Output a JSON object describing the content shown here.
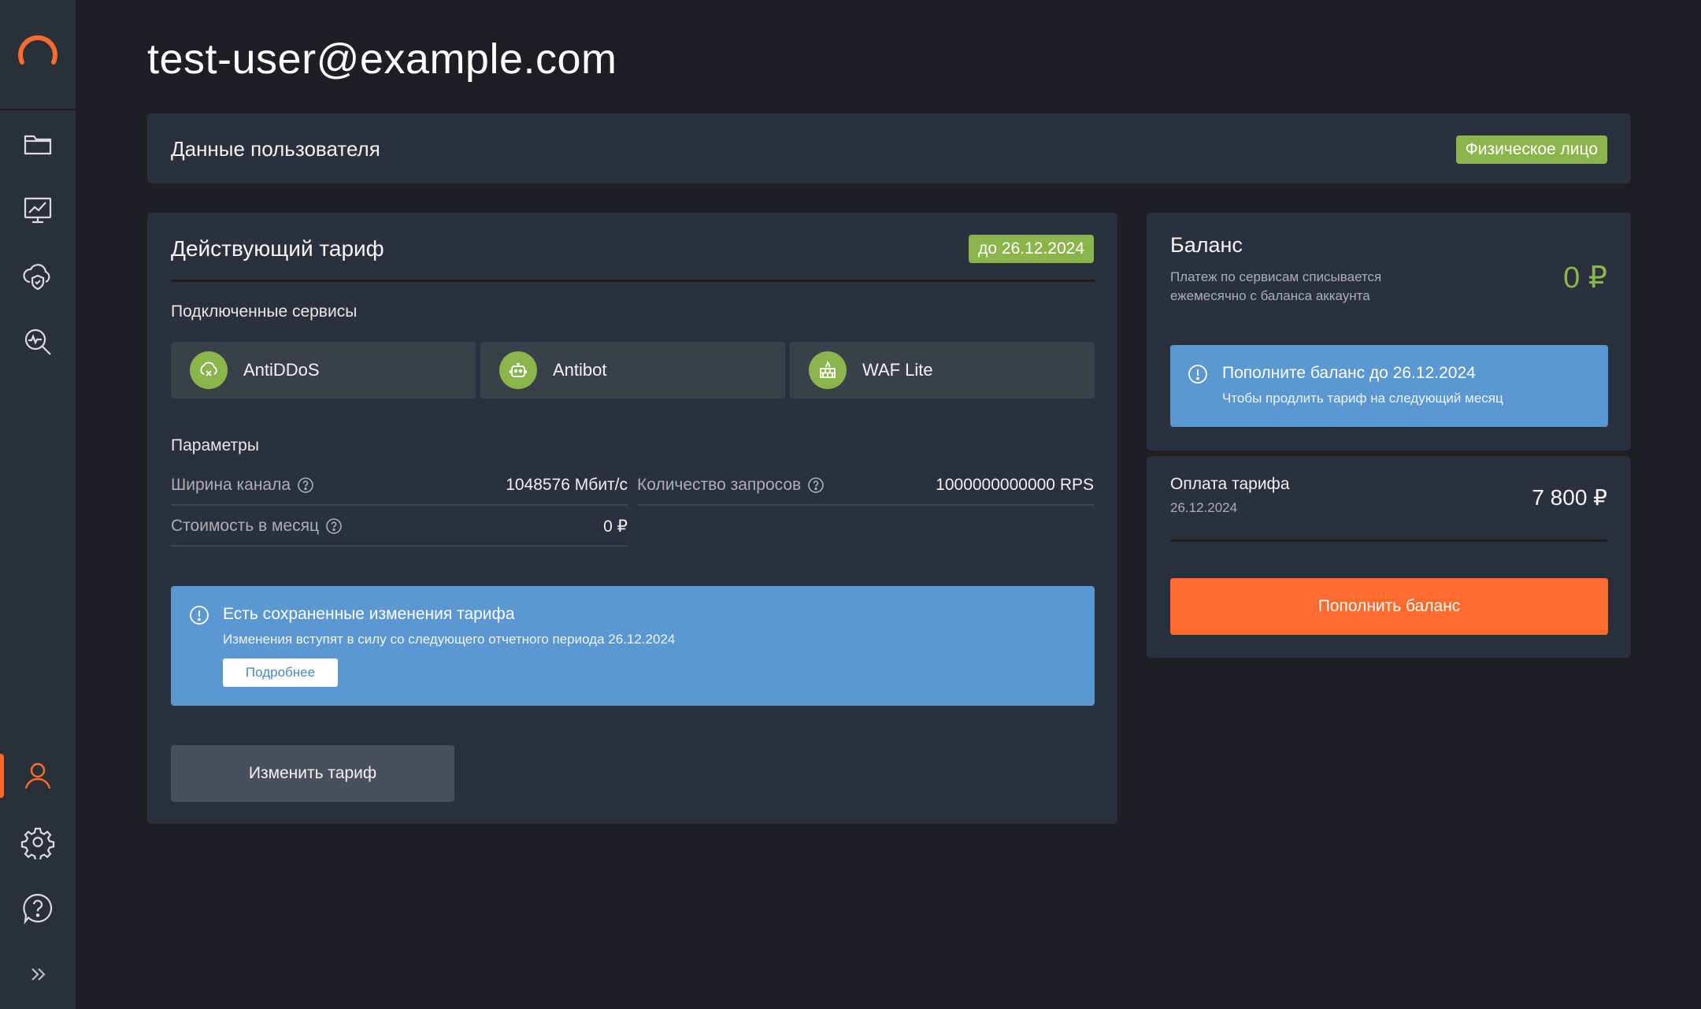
{
  "colors": {
    "accent": "#ff6b2c",
    "success": "#8bb44a",
    "info": "#5b97d0",
    "sidebar": "#2a303a",
    "panel": "#2b313c",
    "background": "#1d1f24"
  },
  "sidebar": {
    "logo": "logo-icon",
    "items": [
      {
        "icon": "folder-icon"
      },
      {
        "icon": "monitor-chart-icon"
      },
      {
        "icon": "cloud-shield-icon"
      },
      {
        "icon": "search-analytics-icon"
      },
      {
        "icon": "user-icon",
        "active": true
      },
      {
        "icon": "gear-icon"
      },
      {
        "icon": "help-icon"
      },
      {
        "icon": "expand-icon"
      }
    ]
  },
  "header": {
    "title": "test-user@example.com"
  },
  "user_panel": {
    "title": "Данные пользователя",
    "badge": "Физическое лицо"
  },
  "tariff": {
    "title": "Действующий тариф",
    "valid_until": "до 26.12.2024",
    "services_label": "Подключенные сервисы",
    "services": [
      {
        "name": "AntiDDoS",
        "icon": "antiddos-icon"
      },
      {
        "name": "Antibot",
        "icon": "robot-icon"
      },
      {
        "name": "WAF Lite",
        "icon": "firewall-icon"
      }
    ],
    "params_label": "Параметры",
    "params": {
      "bandwidth_label": "Ширина канала",
      "bandwidth_value": "1048576 Мбит/с",
      "requests_label": "Количество запросов",
      "requests_value": "1000000000000 RPS",
      "cost_label": "Стоимость в месяц",
      "cost_value": "0 ₽"
    },
    "notice": {
      "title": "Есть сохраненные изменения тарифа",
      "text": "Изменения вступят в силу со следующего отчетного периода 26.12.2024",
      "button": "Подробнее"
    },
    "change_button": "Изменить тариф"
  },
  "balance": {
    "title": "Баланс",
    "description": "Платеж по сервисам списывается ежемесячно с баланса аккаунта",
    "amount": "0 ₽",
    "notice": {
      "title": "Пополните баланс до 26.12.2024",
      "text": "Чтобы продлить тариф на следующий месяц"
    }
  },
  "payment": {
    "title": "Оплата тарифа",
    "date": "26.12.2024",
    "amount": "7 800 ₽",
    "topup_button": "Пополнить баланс"
  }
}
